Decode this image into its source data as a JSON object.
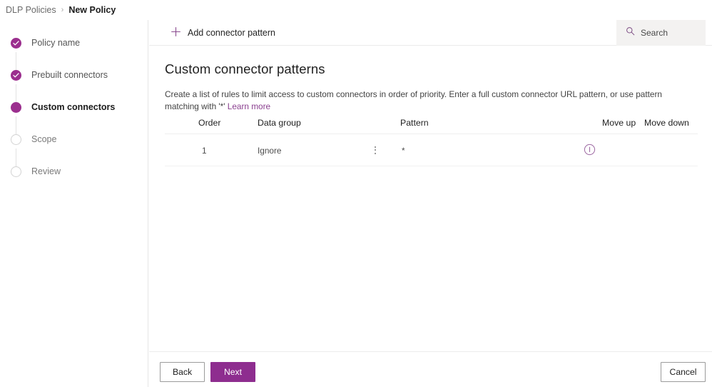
{
  "breadcrumb": {
    "parent": "DLP Policies",
    "separator": "›",
    "current": "New Policy"
  },
  "wizard": {
    "steps": [
      {
        "label": "Policy name",
        "state": "done",
        "icon": "check-circle-icon"
      },
      {
        "label": "Prebuilt connectors",
        "state": "done",
        "icon": "check-circle-icon"
      },
      {
        "label": "Custom connectors",
        "state": "current",
        "icon": "filled-circle-icon"
      },
      {
        "label": "Scope",
        "state": "todo",
        "icon": "empty-circle-icon"
      },
      {
        "label": "Review",
        "state": "todo",
        "icon": "empty-circle-icon"
      }
    ]
  },
  "commandbar": {
    "add_pattern_label": "Add connector pattern",
    "add_pattern_icon": "plus-icon",
    "search_icon": "search-icon",
    "search_placeholder": "Search",
    "search_value": ""
  },
  "main": {
    "title": "Custom connector patterns",
    "description_pre": "Create a list of rules to limit access to custom connectors in order of priority. Enter a full custom connector URL pattern, or use pattern matching with '*' ",
    "description_link": "Learn more"
  },
  "table": {
    "columns": [
      "Order",
      "Data group",
      "Pattern",
      "Move up",
      "Move down"
    ],
    "rows": [
      {
        "order": "1",
        "data_group": "Ignore",
        "group_menu_icon": "kebab-menu-icon",
        "pattern": "*",
        "move_up_icon": "info-circle-icon",
        "move_down": ""
      }
    ]
  },
  "footer": {
    "back_label": "Back",
    "next_label": "Next",
    "cancel_label": "Cancel"
  },
  "colors": {
    "accent": "#8e2d8f",
    "accent_light": "#9b2f8e",
    "link": "#8a3f8f",
    "search_bg": "#f3f2f1",
    "border": "#e6e6e6"
  }
}
